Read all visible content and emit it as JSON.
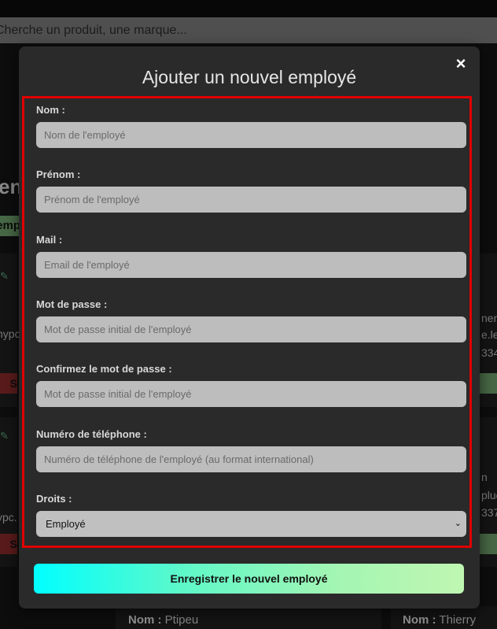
{
  "background": {
    "search_placeholder": "Cherche un produit, une marque...",
    "heading_fragment": "en",
    "green_button_fragment": "emp",
    "left_red_button_fragment": "S",
    "left_text_fragment_1": "nypc",
    "left_text_fragment_2": "ypc.",
    "right_text_fragment_1a": "nenc",
    "right_text_fragment_1b": "e.le",
    "right_text_fragment_1c": "334",
    "right_text_fragment_2a": "n",
    "right_text_fragment_2b": "pluc",
    "right_text_fragment_2c": "337",
    "bottom_card_1": {
      "label": "Nom :",
      "value": "Ptipeu"
    },
    "bottom_card_2": {
      "label": "Nom :",
      "value": "Thierry"
    }
  },
  "modal": {
    "close_glyph": "×",
    "title": "Ajouter un nouvel employé",
    "fields": {
      "nom": {
        "label": "Nom :",
        "placeholder": "Nom de l'employé"
      },
      "prenom": {
        "label": "Prénom :",
        "placeholder": "Prénom de l'employé"
      },
      "mail": {
        "label": "Mail :",
        "placeholder": "Email de l'employé"
      },
      "password": {
        "label": "Mot de passe :",
        "placeholder": "Mot de passe initial de l'employé"
      },
      "confirm_password": {
        "label": "Confirmez le mot de passe :",
        "placeholder": "Mot de passe initial de l'employé"
      },
      "phone": {
        "label": "Numéro de téléphone :",
        "placeholder": "Numéro de téléphone de l'employé (au format international)"
      },
      "rights": {
        "label": "Droits :",
        "selected": "Employé"
      }
    },
    "submit_label": "Enregistrer le nouvel employé"
  },
  "colors": {
    "highlight_border": "#e00000",
    "submit_gradient_start": "#00ffff",
    "submit_gradient_end": "#bff7b2"
  }
}
